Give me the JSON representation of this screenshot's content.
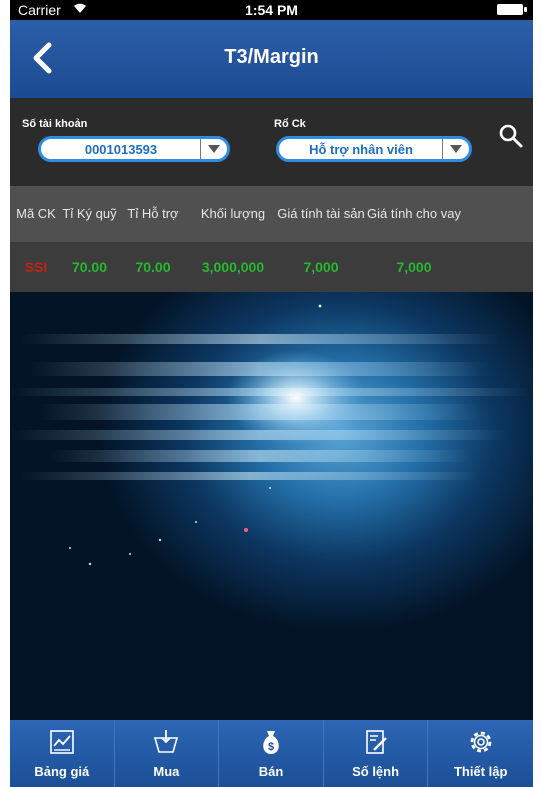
{
  "status_bar": {
    "carrier": "Carrier",
    "time": "1:54 PM"
  },
  "nav": {
    "title": "T3/Margin",
    "back_icon": "chevron-left-icon"
  },
  "filters": {
    "account": {
      "label": "Số tài khoản",
      "value": "0001013593"
    },
    "basket": {
      "label": "Rổ Ck",
      "value": "Hỗ trợ nhân viên"
    },
    "search_icon": "search-icon"
  },
  "table": {
    "headers": [
      "Mã CK",
      "Tỉ Ký quỹ",
      "Tỉ Hỗ trợ",
      "Khối lượng",
      "Giá tính tài sản",
      "Giá tính cho vay"
    ],
    "rows": [
      {
        "code": "SSI",
        "margin_ratio": "70.00",
        "support_ratio": "70.00",
        "volume": "3,000,000",
        "asset_price": "7,000",
        "loan_price": "7,000"
      }
    ]
  },
  "tabs": [
    {
      "label": "Bảng giá",
      "icon": "chart-icon"
    },
    {
      "label": "Mua",
      "icon": "buy-icon"
    },
    {
      "label": "Bán",
      "icon": "money-bag-icon"
    },
    {
      "label": "Số lệnh",
      "icon": "order-book-icon"
    },
    {
      "label": "Thiết lập",
      "icon": "gear-icon"
    }
  ],
  "colors": {
    "nav": "#1e4f98",
    "accent": "#2e8de0",
    "positive": "#27b82f",
    "negative": "#c4221b"
  }
}
